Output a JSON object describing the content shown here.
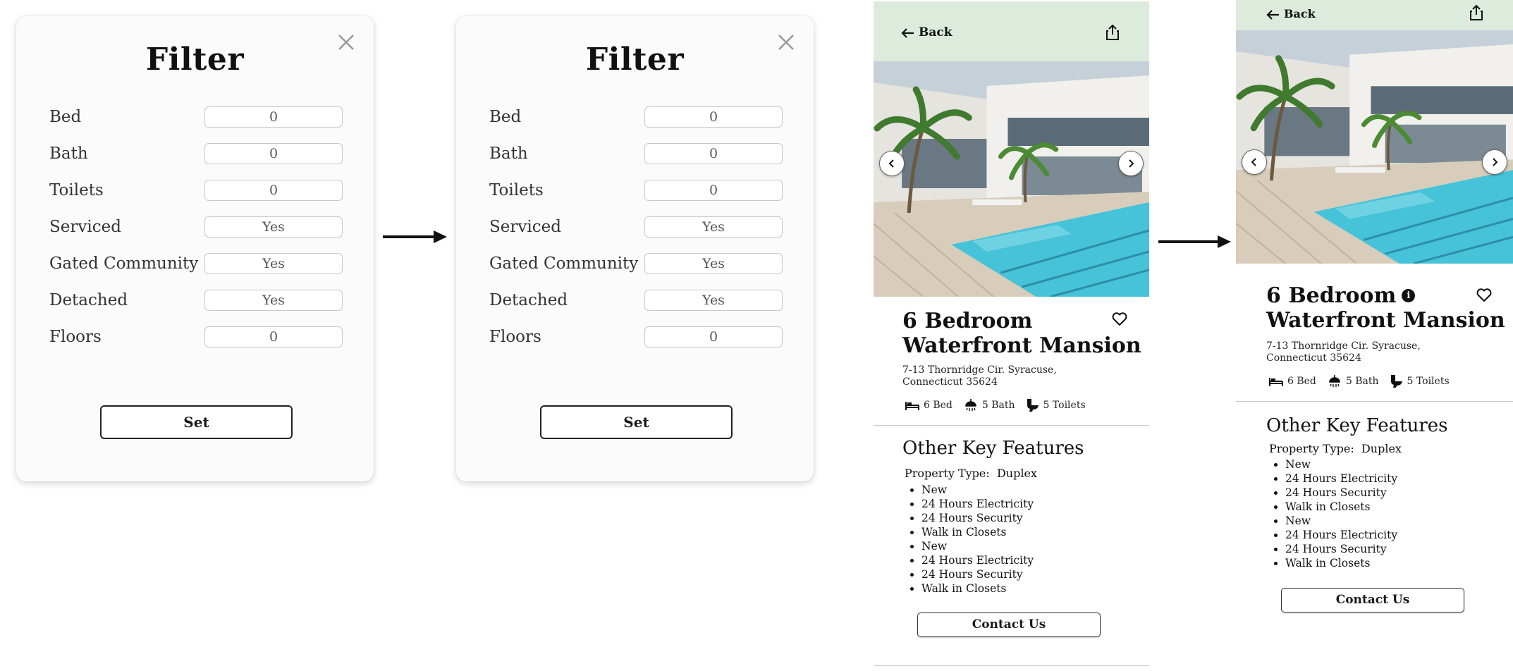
{
  "filter": {
    "title": "Filter",
    "rows": [
      {
        "label": "Bed",
        "value": "0"
      },
      {
        "label": "Bath",
        "value": "0"
      },
      {
        "label": "Toilets",
        "value": "0"
      },
      {
        "label": "Serviced",
        "value": "Yes"
      },
      {
        "label": "Gated Community",
        "value": "Yes"
      },
      {
        "label": "Detached",
        "value": "Yes"
      },
      {
        "label": "Floors",
        "value": "0"
      }
    ],
    "set_label": "Set"
  },
  "property": {
    "back_label": "Back",
    "title_line1": "6 Bedroom",
    "title_line2": "Waterfront Mansion",
    "address": "7-13 Thornridge Cir. Syracuse, Connecticut 35624",
    "bed": "6 Bed",
    "bath": "5 Bath",
    "toilets": "5 Toilets",
    "other_features_title": "Other Key Features",
    "property_type_label": "Property Type:",
    "property_type_value": "Duplex",
    "features": [
      "New",
      "24 Hours Electricity",
      "24 Hours Security",
      "Walk in Closets",
      "New",
      "24 Hours Electricity",
      "24 Hours Security",
      "Walk in Closets"
    ],
    "contact_label": "Contact Us"
  },
  "colors": {
    "topbar": "#dcebdc",
    "pool": "#46c2d9",
    "sky": "#c9d4dd"
  },
  "icons": [
    "close-icon",
    "arrow-right-icon",
    "arrow-left-icon",
    "share-icon",
    "chevron-left-icon",
    "chevron-right-icon",
    "heart-icon",
    "info-icon",
    "bed-icon",
    "shower-icon",
    "toilet-icon"
  ]
}
